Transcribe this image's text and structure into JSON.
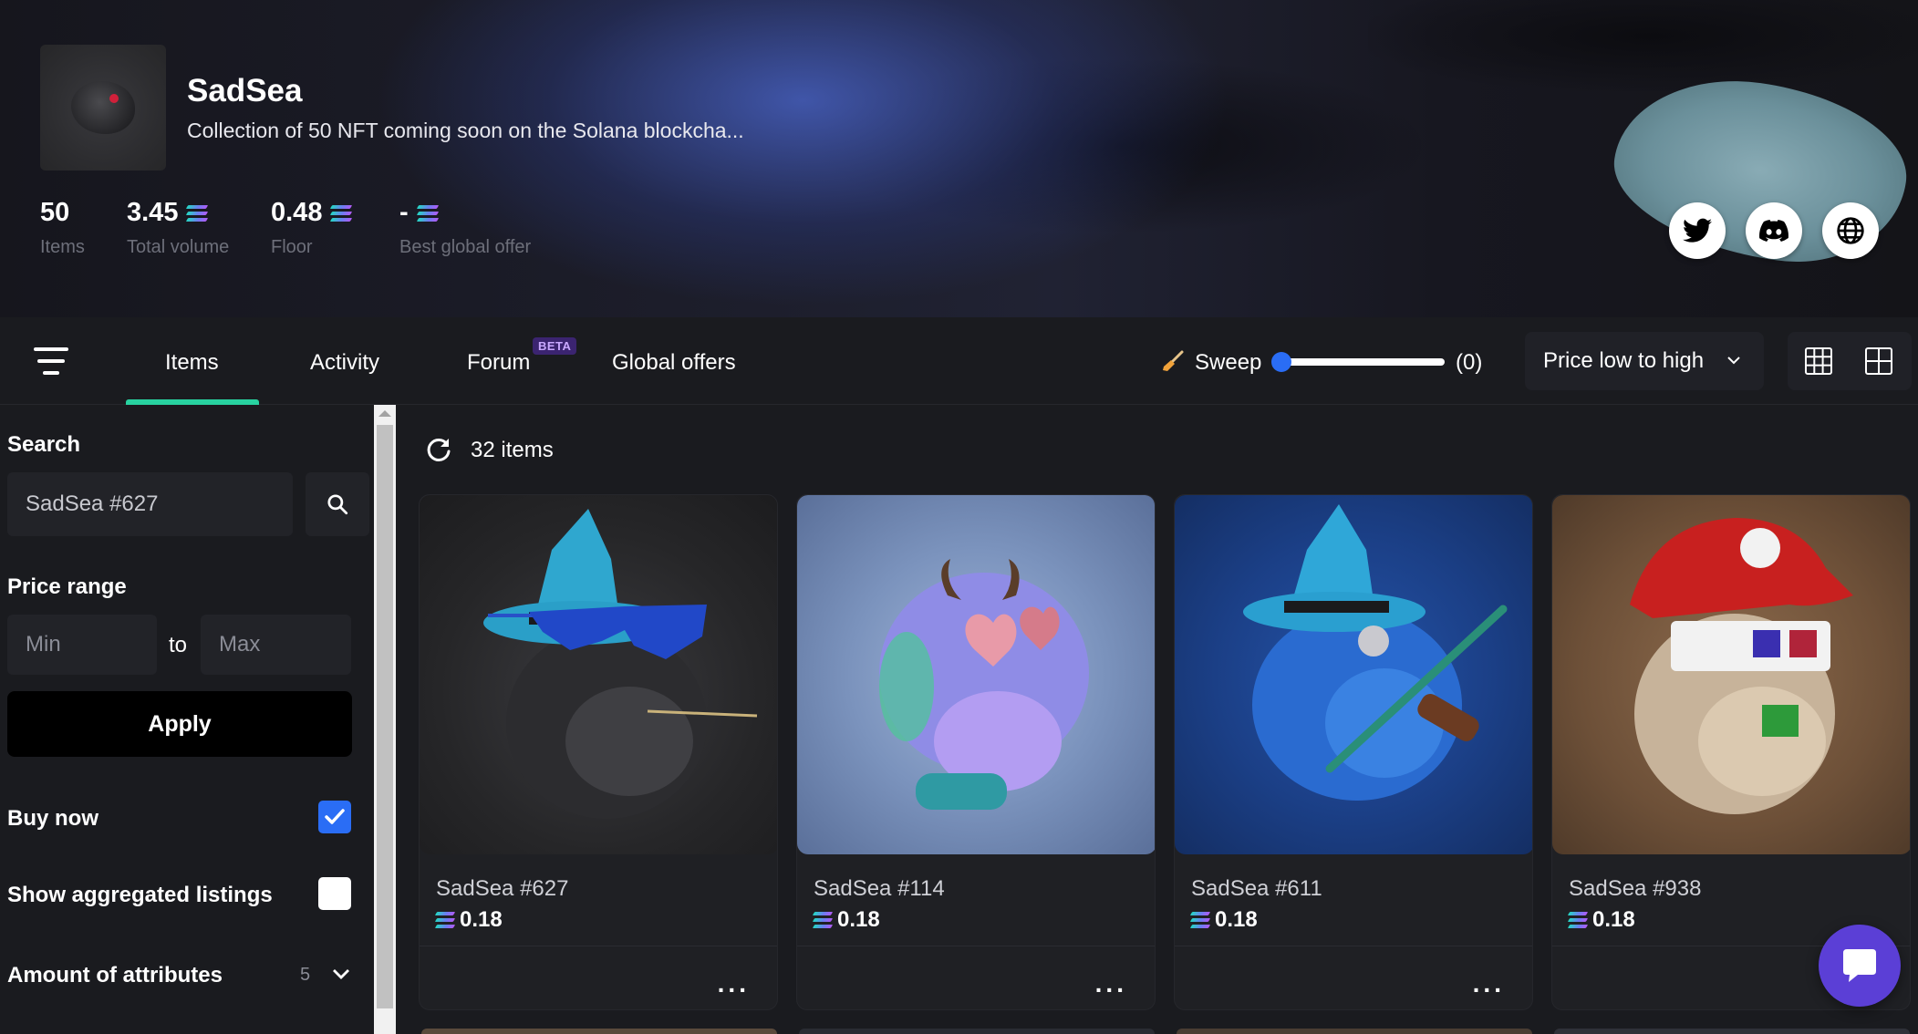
{
  "collection": {
    "name": "SadSea",
    "description": "Collection of 50 NFT coming soon on the Solana blockcha..."
  },
  "stats": [
    {
      "value": "50",
      "label": "Items",
      "currency_icon": false
    },
    {
      "value": "3.45",
      "label": "Total volume",
      "currency_icon": true
    },
    {
      "value": "0.48",
      "label": "Floor",
      "currency_icon": true
    },
    {
      "value": "-",
      "label": "Best global offer",
      "currency_icon": true
    }
  ],
  "social": [
    {
      "icon": "twitter-icon"
    },
    {
      "icon": "discord-icon"
    },
    {
      "icon": "globe-icon"
    }
  ],
  "tabs": [
    {
      "label": "Items",
      "active": true
    },
    {
      "label": "Activity",
      "active": false
    },
    {
      "label": "Forum",
      "active": false,
      "badge": "BETA"
    },
    {
      "label": "Global offers",
      "active": false
    }
  ],
  "sweep": {
    "label": "Sweep",
    "count": "(0)",
    "value": 0
  },
  "sort": {
    "selected": "Price low to high"
  },
  "sidebar": {
    "search_label": "Search",
    "search_value": "SadSea #627",
    "price_label": "Price range",
    "min_placeholder": "Min",
    "to_label": "to",
    "max_placeholder": "Max",
    "apply_label": "Apply",
    "buy_now_label": "Buy now",
    "buy_now_checked": true,
    "aggregated_label": "Show aggregated listings",
    "aggregated_checked": false,
    "attributes_label": "Amount of attributes",
    "attributes_count": "5"
  },
  "results": {
    "count_label": "32 items"
  },
  "cards": [
    {
      "name": "SadSea #627",
      "price": "0.18",
      "more": "..."
    },
    {
      "name": "SadSea #114",
      "price": "0.18",
      "more": "..."
    },
    {
      "name": "SadSea #611",
      "price": "0.18",
      "more": "..."
    },
    {
      "name": "SadSea #938",
      "price": "0.18",
      "more": "..."
    }
  ],
  "colors": {
    "accent_green": "#28d2a0",
    "checkbox_blue": "#2a6df5",
    "chat_purple": "#5b3fd6",
    "beta_purple": "#3b2470"
  }
}
